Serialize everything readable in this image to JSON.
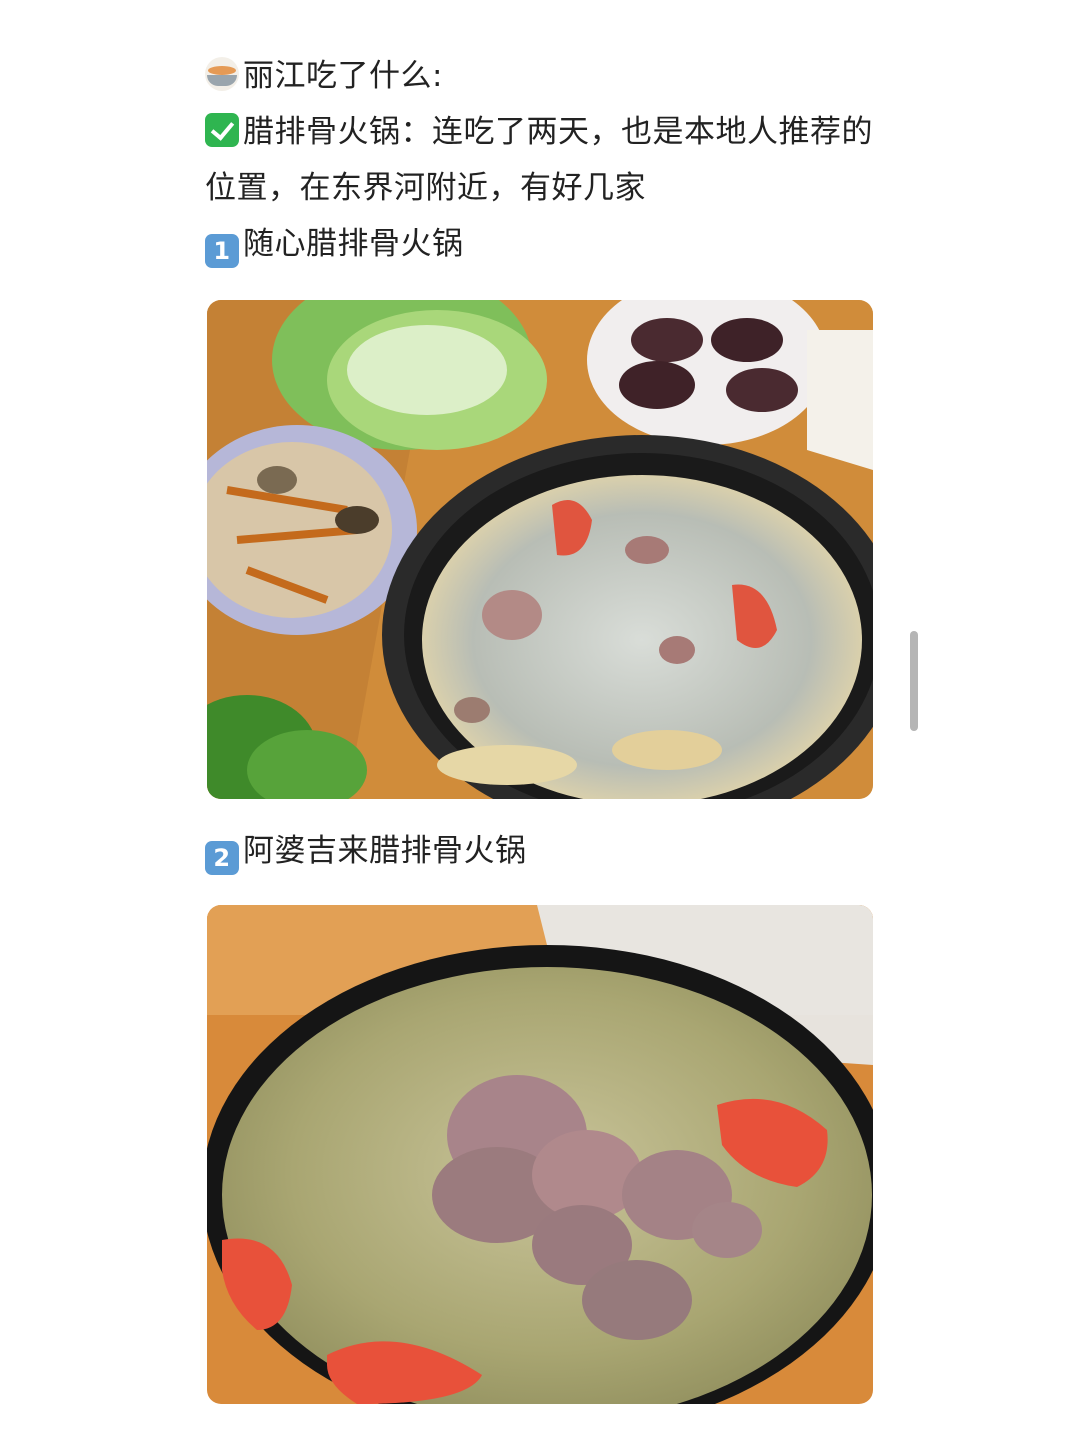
{
  "note": {
    "heading": "丽江吃了什么:",
    "heading_icon": "bowl-icon",
    "recommendation": "腊排骨火锅：连吃了两天，也是本地人推荐的位置，在东界河附近，有好几家",
    "recommendation_icon": "check-mark-icon",
    "places": [
      {
        "number": "1",
        "name": "随心腊排骨火锅"
      },
      {
        "number": "2",
        "name": "阿婆吉来腊排骨火锅"
      }
    ]
  },
  "colors": {
    "text": "#222222",
    "check_green": "#2fb550",
    "keycap_blue": "#5b9bd5"
  }
}
